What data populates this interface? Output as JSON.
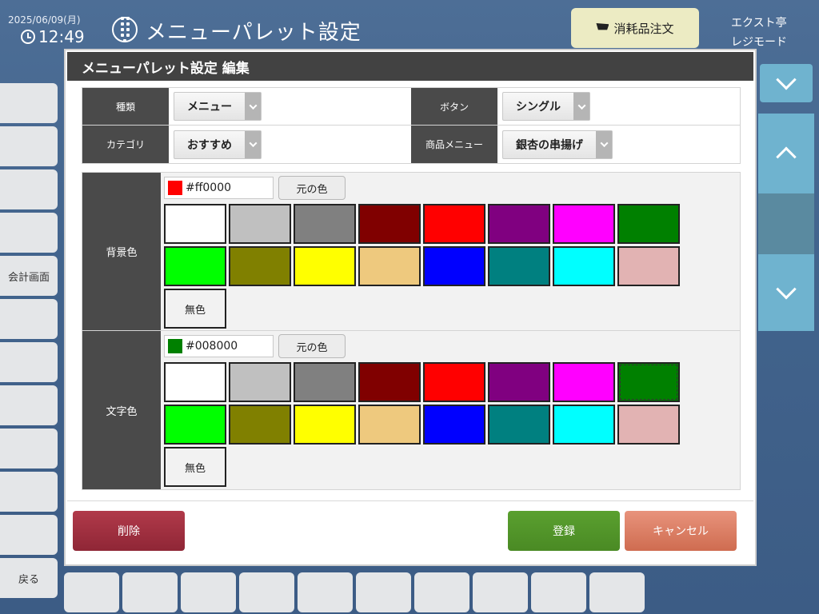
{
  "header": {
    "date": "2025/06/09(月)",
    "time": "12:49",
    "title": "メニューパレット設定",
    "order_button": "消耗品注文",
    "store_name": "エクスト亭",
    "mode": "レジモード"
  },
  "sidebar": {
    "items": [
      "",
      "",
      "",
      "",
      "会計画面",
      "",
      "",
      "",
      "",
      "",
      ""
    ],
    "back_label": "戻る"
  },
  "dialog": {
    "title": "メニューパレット設定 編集",
    "form": {
      "type_label": "種類",
      "type_value": "メニュー",
      "button_label": "ボタン",
      "button_value": "シングル",
      "category_label": "カテゴリ",
      "category_value": "おすすめ",
      "item_menu_label": "商品メニュー",
      "item_menu_value": "銀杏の串揚げ"
    },
    "background_color": {
      "label": "背景色",
      "hex": "#ff0000",
      "original_button": "元の色",
      "none_label": "無色"
    },
    "text_color": {
      "label": "文字色",
      "hex": "#008000",
      "original_button": "元の色",
      "none_label": "無色"
    },
    "palette": [
      "#ffffff",
      "#c0c0c0",
      "#808080",
      "#800000",
      "#ff0000",
      "#800080",
      "#ff00ff",
      "#008000",
      "#00ff00",
      "#808000",
      "#ffff00",
      "#eec97e",
      "#0000ff",
      "#008080",
      "#00ffff",
      "#e2b3b3"
    ],
    "buttons": {
      "delete": "削除",
      "register": "登録",
      "cancel": "キャンセル"
    }
  },
  "colors": {
    "dialog_title_bg": "#424242",
    "label_bg": "#4a4a4a",
    "delete": "#9e2f3f",
    "register": "#529529",
    "cancel": "#dc7e64",
    "order_button": "#ecebc3",
    "scroll_accent": "#6fb3cf"
  }
}
